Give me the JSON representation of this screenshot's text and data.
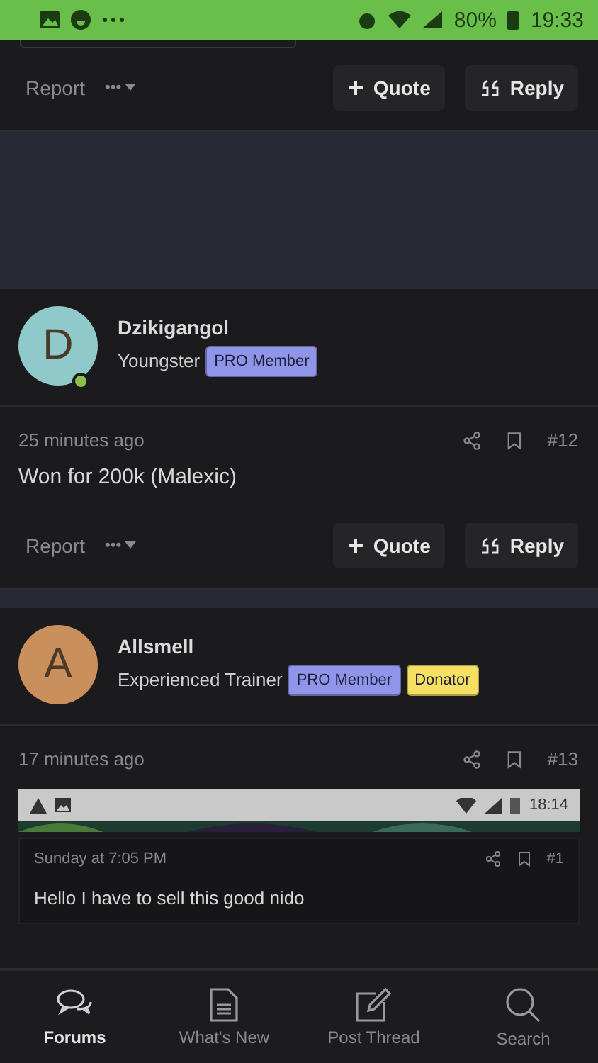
{
  "status_bar": {
    "battery": "80%",
    "time": "19:33"
  },
  "posts": [
    {
      "kind": "tail",
      "actions": {
        "report": "Report",
        "more": "•••",
        "quote": "Quote",
        "reply": "Reply"
      }
    },
    {
      "kind": "full",
      "author": {
        "initial": "D",
        "name": "Dzikigangol",
        "online": true,
        "title": "Youngster",
        "badges": [
          {
            "label": "PRO Member",
            "color": "#8f95e8"
          }
        ]
      },
      "time": "25 minutes ago",
      "number": "#12",
      "body": "Won for 200k (Malexic)",
      "actions": {
        "report": "Report",
        "more": "•••",
        "quote": "Quote",
        "reply": "Reply"
      }
    },
    {
      "kind": "embed",
      "author": {
        "initial": "A",
        "name": "Allsmell",
        "online": false,
        "title": "Experienced Trainer",
        "badges": [
          {
            "label": "PRO Member",
            "color": "#8f95e8"
          },
          {
            "label": "Donator",
            "color": "#f5e063"
          }
        ]
      },
      "time": "17 minutes ago",
      "number": "#13",
      "embed": {
        "time": "18:14",
        "post_time": "Sunday at 7:05 PM",
        "number": "#1",
        "body": "Hello I have to sell this good nido"
      }
    }
  ],
  "nav": [
    {
      "label": "Forums",
      "selected": true
    },
    {
      "label": "What's New",
      "selected": false
    },
    {
      "label": "Post Thread",
      "selected": false
    },
    {
      "label": "Search",
      "selected": false
    }
  ]
}
